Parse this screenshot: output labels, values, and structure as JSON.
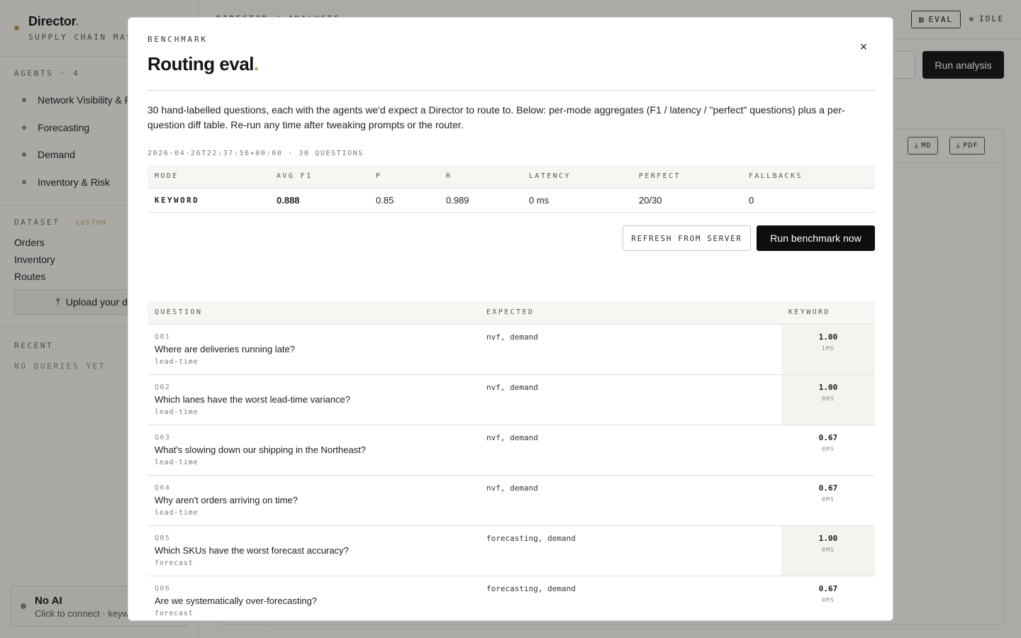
{
  "app": {
    "brand": "Director",
    "brand_accent": ".",
    "brand_sub": "SUPPLY CHAIN MASTER",
    "agents_head": "AGENTS · 4",
    "agents": [
      "Network Visibility & Flows",
      "Forecasting",
      "Demand",
      "Inventory & Risk"
    ],
    "dataset_head": "DATASET",
    "dataset_badge": "· CUSTOM",
    "dataset_items": [
      "Orders",
      "Inventory",
      "Routes"
    ],
    "upload_label": "Upload your data",
    "recent_head": "RECENT",
    "recent_empty": "NO QUERIES YET",
    "ai_title": "No AI",
    "ai_sub": "Click to connect · keyword routing",
    "crumb": "DIRECTOR / ANALYSIS",
    "eval_label": "EVAL",
    "status": "IDLE",
    "run_analysis": "Run analysis",
    "md_label": "MD",
    "pdf_label": "PDF"
  },
  "modal": {
    "eyebrow": "BENCHMARK",
    "title": "Routing eval",
    "title_accent": ".",
    "close": "×",
    "description": "30 hand-labelled questions, each with the agents we'd expect a Director to route to. Below: per-mode aggregates (F1 / latency / \"perfect\" questions) plus a per-question diff table. Re-run any time after tweaking prompts or the router.",
    "meta": "2026-04-26T22:37:56+00:00 · 30 QUESTIONS",
    "agg_headers": [
      "MODE",
      "AVG F1",
      "P",
      "R",
      "LATENCY",
      "PERFECT",
      "FALLBACKS"
    ],
    "agg_rows": [
      {
        "mode": "KEYWORD",
        "f1": "0.888",
        "p": "0.85",
        "r": "0.989",
        "latency": "0 ms",
        "perfect": "20/30",
        "fallbacks": "0"
      }
    ],
    "refresh_label": "REFRESH FROM SERVER",
    "run_label": "Run benchmark now",
    "q_headers": [
      "QUESTION",
      "EXPECTED",
      "KEYWORD"
    ],
    "questions": [
      {
        "id": "Q01",
        "text": "Where are deliveries running late?",
        "tag": "lead-time",
        "expected": "nvf, demand",
        "score": "1.00",
        "ms": "1MS",
        "perfect": true
      },
      {
        "id": "Q02",
        "text": "Which lanes have the worst lead-time variance?",
        "tag": "lead-time",
        "expected": "nvf, demand",
        "score": "1.00",
        "ms": "0MS",
        "perfect": true
      },
      {
        "id": "Q03",
        "text": "What's slowing down our shipping in the Northeast?",
        "tag": "lead-time",
        "expected": "nvf, demand",
        "score": "0.67",
        "ms": "0MS",
        "perfect": false
      },
      {
        "id": "Q04",
        "text": "Why aren't orders arriving on time?",
        "tag": "lead-time",
        "expected": "nvf, demand",
        "score": "0.67",
        "ms": "0MS",
        "perfect": false
      },
      {
        "id": "Q05",
        "text": "Which SKUs have the worst forecast accuracy?",
        "tag": "forecast",
        "expected": "forecasting, demand",
        "score": "1.00",
        "ms": "0MS",
        "perfect": true
      },
      {
        "id": "Q06",
        "text": "Are we systematically over-forecasting?",
        "tag": "forecast",
        "expected": "forecasting, demand",
        "score": "0.67",
        "ms": "0MS",
        "perfect": false
      }
    ]
  }
}
